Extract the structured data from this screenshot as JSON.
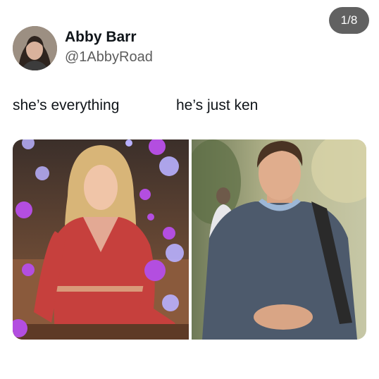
{
  "pagination": {
    "label": "1/8"
  },
  "post": {
    "author_name": "Abby Barr",
    "author_handle": "@1AbbyRoad",
    "avatar_icon": "profile-photo"
  },
  "captions": {
    "left": "she’s everything",
    "right": "he’s just ken"
  },
  "images": {
    "left": {
      "subject": "woman-in-pink-outfit",
      "bokeh_color": "#b34ee0"
    },
    "right": {
      "subject": "man-in-blue-sweater"
    }
  }
}
